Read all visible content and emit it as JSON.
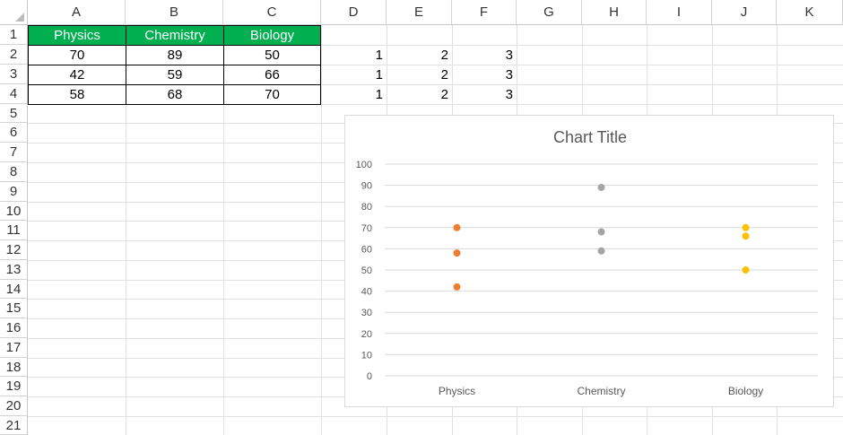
{
  "columns": [
    "A",
    "B",
    "C",
    "D",
    "E",
    "F",
    "G",
    "H",
    "I",
    "J",
    "K"
  ],
  "rows": [
    "1",
    "2",
    "3",
    "4",
    "5",
    "6",
    "7",
    "8",
    "9",
    "10",
    "11",
    "12",
    "13",
    "14",
    "15",
    "16",
    "17",
    "18",
    "19",
    "20",
    "21"
  ],
  "table": {
    "headers": [
      "Physics",
      "Chemistry",
      "Biology"
    ],
    "rows": [
      [
        "70",
        "89",
        "50"
      ],
      [
        "42",
        "59",
        "66"
      ],
      [
        "58",
        "68",
        "70"
      ]
    ],
    "header_fill": "#00b050",
    "header_text_color": "#ffffff"
  },
  "helper_values": [
    [
      "1",
      "2",
      "3"
    ],
    [
      "1",
      "2",
      "3"
    ],
    [
      "1",
      "2",
      "3"
    ]
  ],
  "chart_data": {
    "type": "scatter",
    "title": "Chart Title",
    "categories": [
      "Physics",
      "Chemistry",
      "Biology"
    ],
    "series": [
      {
        "category": "Physics",
        "color": "#ed7d31",
        "values": [
          70,
          42,
          58
        ]
      },
      {
        "category": "Chemistry",
        "color": "#a5a5a5",
        "values": [
          89,
          59,
          68
        ]
      },
      {
        "category": "Biology",
        "color": "#ffc000",
        "values": [
          50,
          66,
          70
        ]
      }
    ],
    "y_ticks": [
      "0",
      "10",
      "20",
      "30",
      "40",
      "50",
      "60",
      "70",
      "80",
      "90",
      "100"
    ],
    "ylim": [
      0,
      100
    ],
    "grid": true,
    "legend": "none",
    "xlabel": "",
    "ylabel": ""
  }
}
